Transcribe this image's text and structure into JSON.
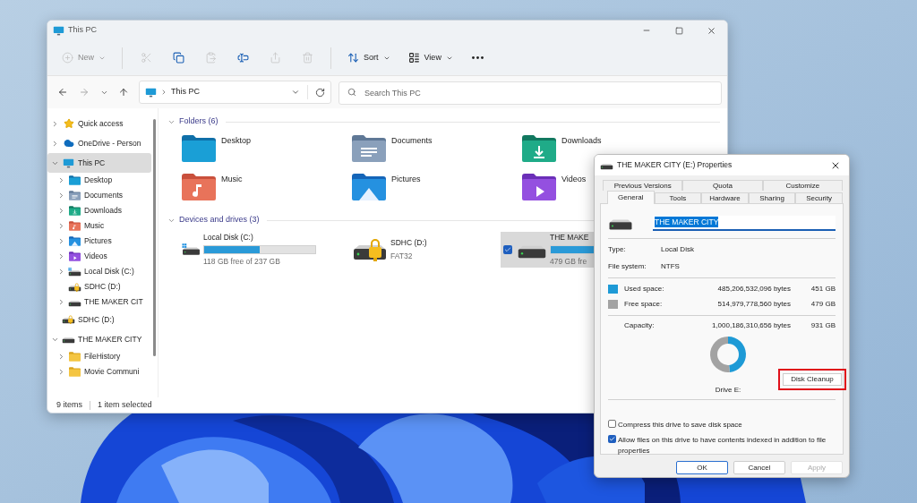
{
  "explorer": {
    "title": "This PC",
    "toolbar": [
      {
        "kind": "new",
        "label": "New",
        "disabled": true
      },
      {
        "kind": "cut",
        "disabled": true
      },
      {
        "kind": "copy",
        "disabled": false
      },
      {
        "kind": "paste",
        "disabled": true
      },
      {
        "kind": "rename",
        "disabled": false
      },
      {
        "kind": "share",
        "disabled": true
      },
      {
        "kind": "delete",
        "disabled": true
      },
      {
        "kind": "sort",
        "label": "Sort",
        "disabled": false
      },
      {
        "kind": "view",
        "label": "View",
        "disabled": false
      },
      {
        "kind": "more",
        "disabled": false
      }
    ],
    "navigation": {
      "forward_disabled": true
    },
    "address": {
      "path": "This PC"
    },
    "search": {
      "placeholder": "Search This PC"
    },
    "sidebar": {
      "items": [
        {
          "kind": "star",
          "label": "Quick access",
          "expanded": false,
          "selected": false
        },
        {
          "kind": "cloud",
          "label": "OneDrive - Person",
          "expanded": false,
          "selected": false
        },
        {
          "kind": "pc",
          "label": "This PC",
          "expanded": true,
          "selected": true,
          "children": [
            {
              "kind": "desktop",
              "label": "Desktop",
              "expanded": false,
              "selected": false
            },
            {
              "kind": "documents",
              "label": "Documents",
              "expanded": false,
              "selected": false
            },
            {
              "kind": "downloads",
              "label": "Downloads",
              "expanded": false,
              "selected": false
            },
            {
              "kind": "music",
              "label": "Music",
              "expanded": false,
              "selected": false
            },
            {
              "kind": "pictures",
              "label": "Pictures",
              "expanded": false,
              "selected": false
            },
            {
              "kind": "videos",
              "label": "Videos",
              "expanded": false,
              "selected": false
            },
            {
              "kind": "system-drive",
              "label": "Local Disk (C:)",
              "expanded": false,
              "selected": false
            },
            {
              "kind": "locked-drive",
              "label": "SDHC (D:)",
              "selected": false
            },
            {
              "kind": "drive",
              "label": "THE MAKER CIT",
              "expanded": false,
              "selected": false
            }
          ]
        },
        {
          "kind": "locked-drive",
          "label": "SDHC (D:)",
          "selected": false
        },
        {
          "kind": "drive",
          "label": "THE MAKER CITY",
          "expanded": true,
          "selected": false,
          "children": [
            {
              "kind": "folder",
              "label": "FileHistory",
              "expanded": false,
              "selected": false
            },
            {
              "kind": "folder",
              "label": "Movie Communi",
              "expanded": false,
              "selected": false
            }
          ]
        }
      ]
    },
    "sections": [
      {
        "kind": "folders",
        "title": "Folders (6)",
        "expanded": true,
        "items": [
          {
            "kind": "desktop",
            "label": "Desktop"
          },
          {
            "kind": "documents",
            "label": "Documents"
          },
          {
            "kind": "downloads",
            "label": "Downloads"
          },
          {
            "kind": "music",
            "label": "Music"
          },
          {
            "kind": "pictures",
            "label": "Pictures"
          },
          {
            "kind": "videos",
            "label": "Videos"
          }
        ]
      },
      {
        "kind": "drives",
        "title": "Devices and drives (3)",
        "expanded": true,
        "items": [
          {
            "kind": "system-drive",
            "label": "Local Disk (C:)",
            "level": 0.5,
            "detail": "118 GB free of 237 GB",
            "selected": false
          },
          {
            "kind": "locked-drive",
            "label": "SDHC (D:)",
            "detail": "FAT32",
            "selected": false
          },
          {
            "kind": "drive",
            "label": "THE MAKE",
            "level": 0.48,
            "detail": "479 GB fre",
            "selected": true
          }
        ]
      }
    ],
    "status_bar": {
      "count": "9 items",
      "selection": "1 item selected"
    }
  },
  "properties": {
    "title": "THE MAKER CITY (E:) Properties",
    "tabs_back": [
      {
        "label": "Previous Versions",
        "selected": false
      },
      {
        "label": "Quota",
        "selected": false
      },
      {
        "label": "Customize",
        "selected": false
      }
    ],
    "tabs_front": [
      {
        "label": "General",
        "selected": true
      },
      {
        "label": "Tools",
        "selected": false
      },
      {
        "label": "Hardware",
        "selected": false
      },
      {
        "label": "Sharing",
        "selected": false
      },
      {
        "label": "Security",
        "selected": false
      }
    ],
    "name_field": {
      "value": "THE MAKER CITY",
      "text_selected": true
    },
    "info": [
      {
        "label": "Type:",
        "value": "Local Disk"
      },
      {
        "label": "File system:",
        "value": "NTFS"
      }
    ],
    "space": [
      {
        "label": "Used space:",
        "bytes": "485,206,532,096 bytes",
        "size": "451 GB",
        "color": "#1e9ad6"
      },
      {
        "label": "Free space:",
        "bytes": "514,979,778,560 bytes",
        "size": "479 GB",
        "color": "#a3a3a3"
      }
    ],
    "capacity": {
      "label": "Capacity:",
      "bytes": "1,000,186,310,656 bytes",
      "size": "931 GB"
    },
    "chart_data": {
      "type": "donut",
      "title": "Drive E:",
      "series": [
        {
          "values": [
            48.5,
            51.5
          ]
        }
      ]
    },
    "cleanup_button": {
      "label": "Disk Cleanup",
      "highlighted": true
    },
    "options": [
      {
        "label": "Compress this drive to save disk space",
        "checked": false
      },
      {
        "label": "Allow files on this drive to have contents indexed in addition to file properties",
        "checked": true
      }
    ],
    "buttons": [
      {
        "label": "OK",
        "kind": "default",
        "disabled": false
      },
      {
        "label": "Cancel",
        "kind": "normal",
        "disabled": false
      },
      {
        "label": "Apply",
        "kind": "normal",
        "disabled": true
      }
    ]
  }
}
